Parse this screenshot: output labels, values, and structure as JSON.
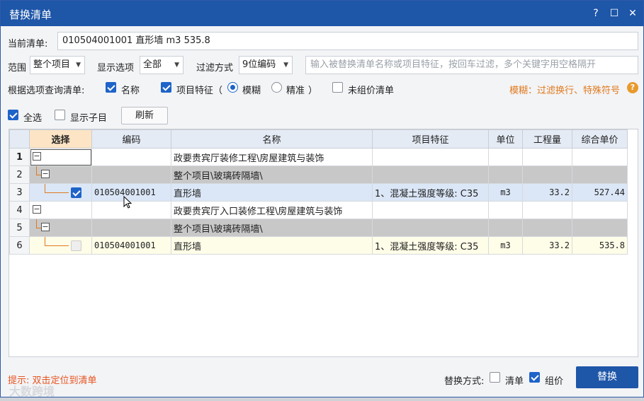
{
  "window": {
    "title": "替换清单",
    "help_label": "?"
  },
  "current": {
    "label": "当前清单:",
    "value": "010504001001 直形墙 m3 535.8"
  },
  "filters": {
    "scope_label": "范围",
    "scope_value": "整个项目",
    "display_label": "显示选项",
    "display_value": "全部",
    "filter_label": "过滤方式",
    "filter_value": "9位编码",
    "search_placeholder": "输入被替换清单名称或项目特征，按回车过滤，多个关键字用空格隔开"
  },
  "query": {
    "label": "根据选项查询清单:",
    "name_label": "名称",
    "name_checked": true,
    "feature_label": "项目特征（",
    "fuzzy_label": "模糊",
    "exact_label": "精准",
    "close_paren": "）",
    "unpriced_label": "未组价清单",
    "unpriced_checked": false,
    "hint": "模糊：过滤换行、特殊符号"
  },
  "toolbar": {
    "select_all_label": "全选",
    "show_children_label": "显示子目",
    "refresh_label": "刷新"
  },
  "table": {
    "headers": [
      "选择",
      "编码",
      "名称",
      "项目特征",
      "单位",
      "工程量",
      "综合单价"
    ],
    "rows": [
      {
        "num": "1",
        "code": "",
        "name": "政要贵宾厅装修工程\\房屋建筑与装饰",
        "feature": "",
        "unit": "",
        "qty": "",
        "price": ""
      },
      {
        "num": "2",
        "code": "",
        "name": "整个项目\\玻璃砖隔墙\\",
        "feature": "",
        "unit": "",
        "qty": "",
        "price": ""
      },
      {
        "num": "3",
        "code": "010504001001",
        "name": "直形墙",
        "feature": "1、混凝土强度等级: C35",
        "unit": "m3",
        "qty": "33.2",
        "price": "527.44"
      },
      {
        "num": "4",
        "code": "",
        "name": "政要贵宾厅入口装修工程\\房屋建筑与装饰",
        "feature": "",
        "unit": "",
        "qty": "",
        "price": ""
      },
      {
        "num": "5",
        "code": "",
        "name": "整个项目\\玻璃砖隔墙\\",
        "feature": "",
        "unit": "",
        "qty": "",
        "price": ""
      },
      {
        "num": "6",
        "code": "010504001001",
        "name": "直形墙",
        "feature": "1、混凝土强度等级: C35",
        "unit": "m3",
        "qty": "33.2",
        "price": "535.8"
      }
    ]
  },
  "footer": {
    "tip": "提示: 双击定位到清单",
    "mode_label": "替换方式:",
    "mode_list_label": "清单",
    "mode_price_label": "组价",
    "replace_label": "替换"
  },
  "watermark": "大数跨境",
  "colors": {
    "titlebar": "#1e56a8",
    "accent": "#1e63c8",
    "hint_orange": "#e07a1f",
    "tip_red": "#e8531f"
  }
}
